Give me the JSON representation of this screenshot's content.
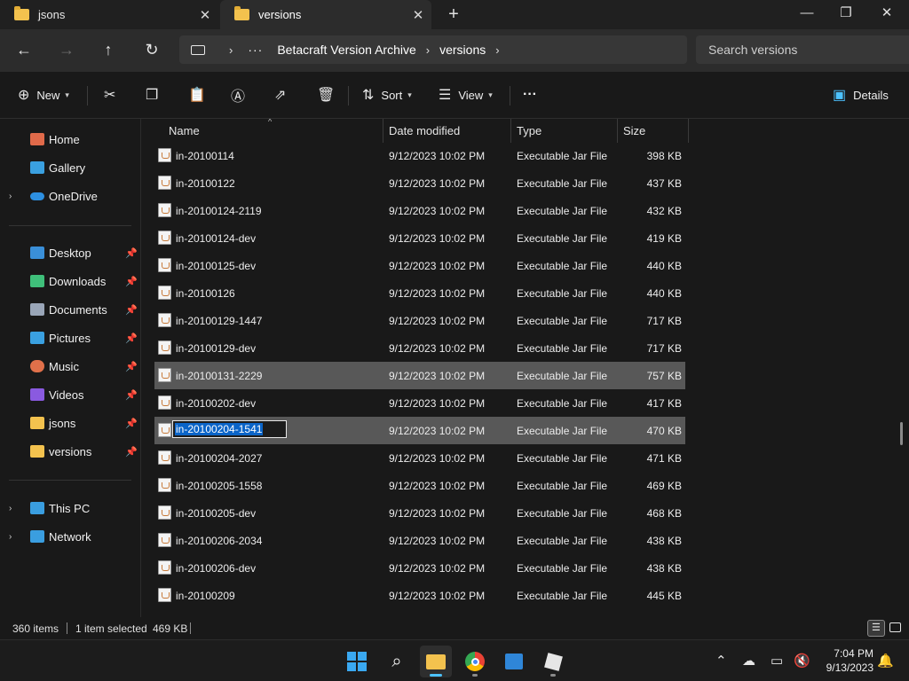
{
  "tabs": [
    {
      "title": "jsons",
      "close": "✕"
    },
    {
      "title": "versions",
      "close": "✕"
    }
  ],
  "new_tab": "+",
  "window_controls": {
    "minimize": "—",
    "maximize": "❐",
    "close": "✕"
  },
  "nav": {
    "back": "←",
    "forward": "→",
    "up": "↑",
    "refresh": "↻"
  },
  "address": {
    "ellipsis": "···",
    "crumbs": [
      "Betacraft Version Archive",
      "versions"
    ],
    "sep": "›"
  },
  "search": {
    "placeholder": "Search versions"
  },
  "commands": {
    "new": "New",
    "sort": "Sort",
    "view": "View",
    "more": "···",
    "details": "Details"
  },
  "sidebar": {
    "top": [
      {
        "label": "Home",
        "icon": "home-icon",
        "color": "#e06a4a"
      },
      {
        "label": "Gallery",
        "icon": "gallery-icon",
        "color": "#3aa0e0"
      },
      {
        "label": "OneDrive",
        "icon": "cloud-icon",
        "color": "#2d8fe0"
      }
    ],
    "pinned": [
      {
        "label": "Desktop",
        "icon": "desktop-icon",
        "color": "#3a8fd8"
      },
      {
        "label": "Downloads",
        "icon": "download-icon",
        "color": "#3fbf7a"
      },
      {
        "label": "Documents",
        "icon": "document-icon",
        "color": "#9aa6b8"
      },
      {
        "label": "Pictures",
        "icon": "pictures-icon",
        "color": "#3aa0e0"
      },
      {
        "label": "Music",
        "icon": "music-icon",
        "color": "#e0704a"
      },
      {
        "label": "Videos",
        "icon": "videos-icon",
        "color": "#8a5ae0"
      },
      {
        "label": "jsons",
        "icon": "folder-icon",
        "color": "#f3c24e"
      },
      {
        "label": "versions",
        "icon": "folder-icon",
        "color": "#f3c24e"
      }
    ],
    "pin_glyph": "📌",
    "bottom": [
      {
        "label": "This PC",
        "icon": "pc-icon",
        "color": "#3a9ee0"
      },
      {
        "label": "Network",
        "icon": "network-icon",
        "color": "#3a9ee0"
      }
    ],
    "expand_glyph": "›"
  },
  "columns": {
    "name": "Name",
    "date": "Date modified",
    "type": "Type",
    "size": "Size",
    "sort_glyph": "^"
  },
  "files": [
    {
      "name": "in-20100114",
      "date": "9/12/2023 10:02 PM",
      "type": "Executable Jar File",
      "size": "398 KB",
      "state": ""
    },
    {
      "name": "in-20100122",
      "date": "9/12/2023 10:02 PM",
      "type": "Executable Jar File",
      "size": "437 KB",
      "state": ""
    },
    {
      "name": "in-20100124-2119",
      "date": "9/12/2023 10:02 PM",
      "type": "Executable Jar File",
      "size": "432 KB",
      "state": ""
    },
    {
      "name": "in-20100124-dev",
      "date": "9/12/2023 10:02 PM",
      "type": "Executable Jar File",
      "size": "419 KB",
      "state": ""
    },
    {
      "name": "in-20100125-dev",
      "date": "9/12/2023 10:02 PM",
      "type": "Executable Jar File",
      "size": "440 KB",
      "state": ""
    },
    {
      "name": "in-20100126",
      "date": "9/12/2023 10:02 PM",
      "type": "Executable Jar File",
      "size": "440 KB",
      "state": ""
    },
    {
      "name": "in-20100129-1447",
      "date": "9/12/2023 10:02 PM",
      "type": "Executable Jar File",
      "size": "717 KB",
      "state": ""
    },
    {
      "name": "in-20100129-dev",
      "date": "9/12/2023 10:02 PM",
      "type": "Executable Jar File",
      "size": "717 KB",
      "state": ""
    },
    {
      "name": "in-20100131-2229",
      "date": "9/12/2023 10:02 PM",
      "type": "Executable Jar File",
      "size": "757 KB",
      "state": "hover"
    },
    {
      "name": "in-20100202-dev",
      "date": "9/12/2023 10:02 PM",
      "type": "Executable Jar File",
      "size": "417 KB",
      "state": ""
    },
    {
      "name": "in-20100204-1541",
      "date": "9/12/2023 10:02 PM",
      "type": "Executable Jar File",
      "size": "470 KB",
      "state": "rename"
    },
    {
      "name": "in-20100204-2027",
      "date": "9/12/2023 10:02 PM",
      "type": "Executable Jar File",
      "size": "471 KB",
      "state": ""
    },
    {
      "name": "in-20100205-1558",
      "date": "9/12/2023 10:02 PM",
      "type": "Executable Jar File",
      "size": "469 KB",
      "state": ""
    },
    {
      "name": "in-20100205-dev",
      "date": "9/12/2023 10:02 PM",
      "type": "Executable Jar File",
      "size": "468 KB",
      "state": ""
    },
    {
      "name": "in-20100206-2034",
      "date": "9/12/2023 10:02 PM",
      "type": "Executable Jar File",
      "size": "438 KB",
      "state": ""
    },
    {
      "name": "in-20100206-dev",
      "date": "9/12/2023 10:02 PM",
      "type": "Executable Jar File",
      "size": "438 KB",
      "state": ""
    },
    {
      "name": "in-20100209",
      "date": "9/12/2023 10:02 PM",
      "type": "Executable Jar File",
      "size": "445 KB",
      "state": ""
    }
  ],
  "status": {
    "count": "360 items",
    "selection": "1 item selected",
    "size": "469 KB"
  },
  "clock": {
    "time": "7:04 PM",
    "date": "9/13/2023"
  },
  "taskbar_apps": [
    "start-icon",
    "search-icon",
    "file-explorer-icon",
    "chrome-icon",
    "store-icon",
    "roblox-icon"
  ],
  "colors": {
    "accent": "#4cc2ff",
    "selection": "#0a64c8",
    "row_selected": "#585858"
  }
}
